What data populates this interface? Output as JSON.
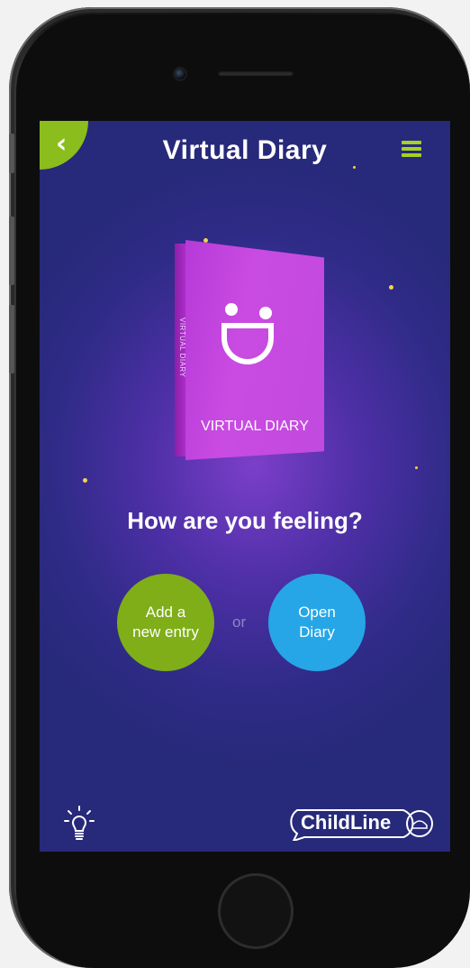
{
  "app": {
    "title": "Virtual Diary",
    "question": "How are you feeling?",
    "book": {
      "cover_label": "VIRTUAL DIARY",
      "spine_label": "VIRTUAL DIARY"
    },
    "actions": {
      "new_entry_label": "Add a\nnew entry",
      "open_diary_label": "Open\nDiary",
      "separator": "or"
    },
    "logo_text": "ChildLine"
  },
  "colors": {
    "accent_green": "#8bbd1c",
    "open_blue": "#26a6e6",
    "book_purple": "#c94be2",
    "star_yellow": "#f5d24a",
    "background_navy": "#2e2b86"
  },
  "icons": {
    "back": "chevron-left-icon",
    "menu": "hamburger-menu-icon",
    "tips": "lightbulb-icon",
    "logo": "childline-logo"
  }
}
